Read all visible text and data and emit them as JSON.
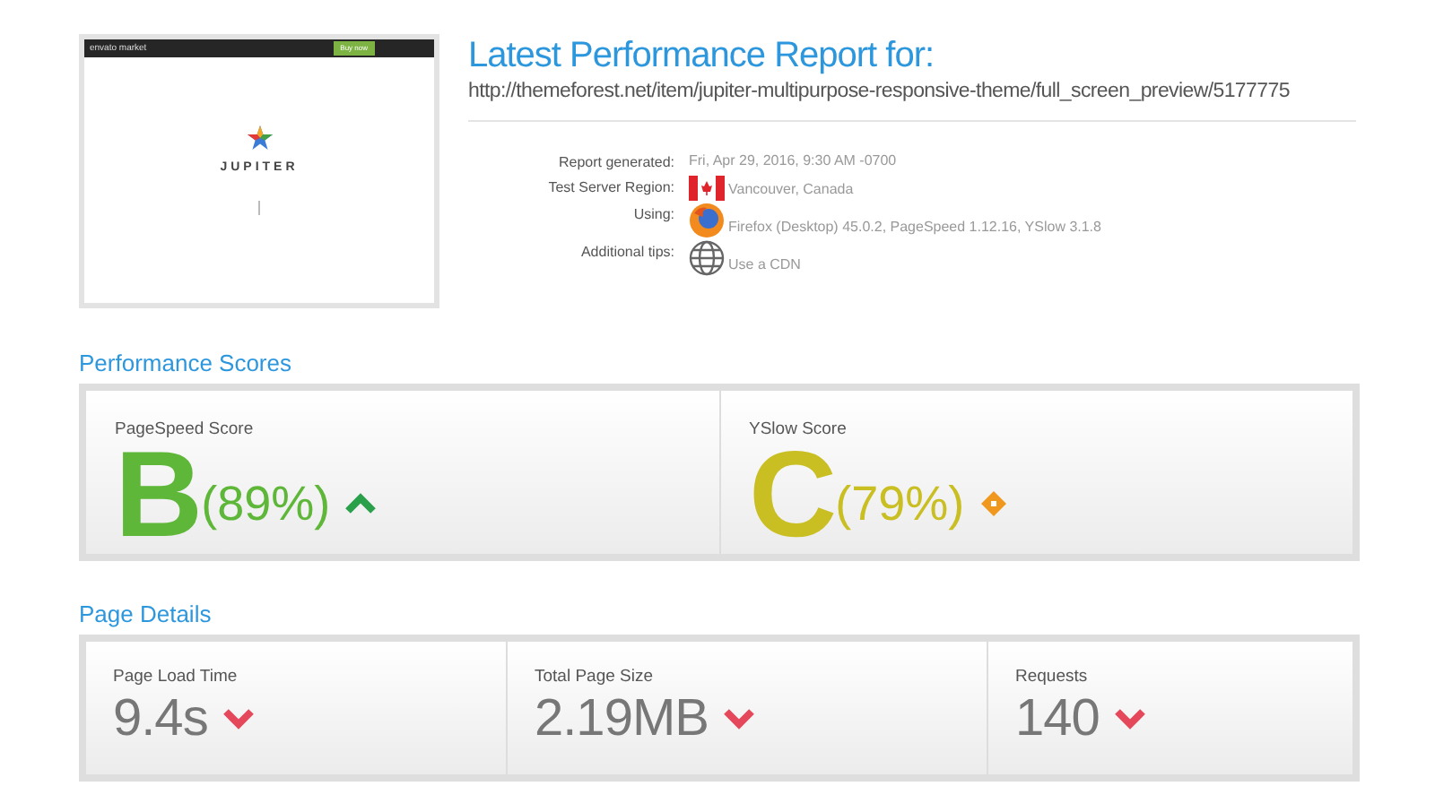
{
  "preview": {
    "brand": "envato market",
    "button": "Buy now",
    "logo_text": "JUPITER"
  },
  "report": {
    "title": "Latest Performance Report for:",
    "url": "http://themeforest.net/item/jupiter-multipurpose-responsive-theme/full_screen_preview/5177775",
    "meta": [
      {
        "label": "Report generated:",
        "value": "Fri, Apr 29, 2016, 9:30 AM -0700",
        "kind": "text"
      },
      {
        "label": "Test Server Region:",
        "value": "Vancouver, Canada",
        "kind": "flag"
      },
      {
        "label": "Using:",
        "value": "Firefox (Desktop) 45.0.2, PageSpeed 1.12.16, YSlow 3.1.8",
        "kind": "browser"
      },
      {
        "label": "Additional tips:",
        "value": "Use a CDN",
        "kind": "globe"
      }
    ]
  },
  "performance_scores": {
    "heading": "Performance Scores",
    "scores": [
      {
        "label": "PageSpeed Score",
        "grade": "B",
        "percent": "(89%)",
        "color": "#5fb73a",
        "kind": "up"
      },
      {
        "label": "YSlow Score",
        "grade": "C",
        "percent": "(79%)",
        "color": "#c9be22",
        "kind": "neutral"
      }
    ]
  },
  "page_details": {
    "heading": "Page Details",
    "items": [
      {
        "label": "Page Load Time",
        "value": "9.4s",
        "kind": "down"
      },
      {
        "label": "Total Page Size",
        "value": "2.19MB",
        "kind": "down"
      },
      {
        "label": "Requests",
        "value": "140",
        "kind": "down"
      }
    ]
  }
}
